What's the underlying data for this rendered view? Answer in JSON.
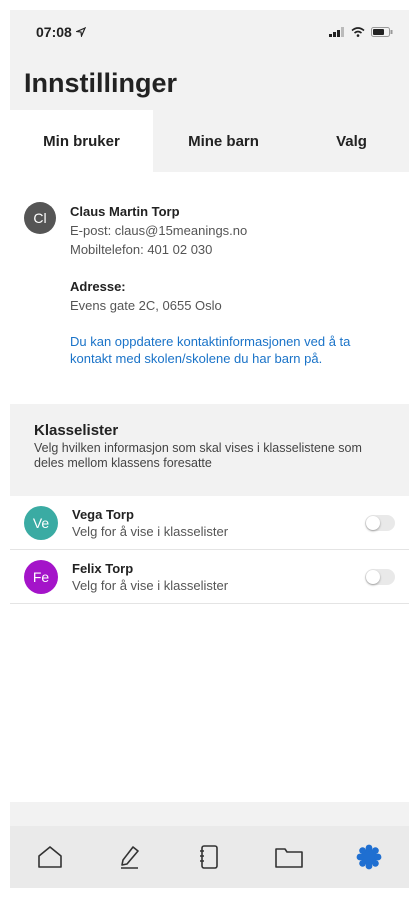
{
  "status_bar": {
    "time": "07:08"
  },
  "header": {
    "title": "Innstillinger"
  },
  "tabs": [
    {
      "label": "Min bruker",
      "active": true
    },
    {
      "label": "Mine barn",
      "active": false
    },
    {
      "label": "Valg",
      "active": false
    }
  ],
  "user": {
    "initials": "Cl",
    "name": "Claus Martin Torp",
    "email": "E-post: claus@15meanings.no",
    "phone": "Mobiltelefon: 401 02 030",
    "address_label": "Adresse:",
    "address": "Evens gate 2C, 0655 Oslo",
    "note": "Du kan oppdatere kontaktinformasjonen ved å ta kontakt med skolen/skolene du har barn på."
  },
  "class_lists": {
    "heading": "Klasselister",
    "description": "Velg hvilken informasjon som skal vises i klasselistene som deles mellom klassens foresatte"
  },
  "children": [
    {
      "initials": "Ve",
      "name": "Vega Torp",
      "subtitle": "Velg for å vise i klasselister",
      "color": "#3aaba3",
      "enabled": false
    },
    {
      "initials": "Fe",
      "name": "Felix Torp",
      "subtitle": "Velg for å vise i klasselister",
      "color": "#a414c9",
      "enabled": false
    }
  ],
  "bottom_nav": [
    {
      "icon": "home-icon"
    },
    {
      "icon": "pencil-icon"
    },
    {
      "icon": "notebook-icon"
    },
    {
      "icon": "folder-icon"
    },
    {
      "icon": "settings-gear-icon",
      "active": true
    }
  ],
  "colors": {
    "accent": "#1a73c8",
    "active_nav": "#1f6fd1"
  }
}
